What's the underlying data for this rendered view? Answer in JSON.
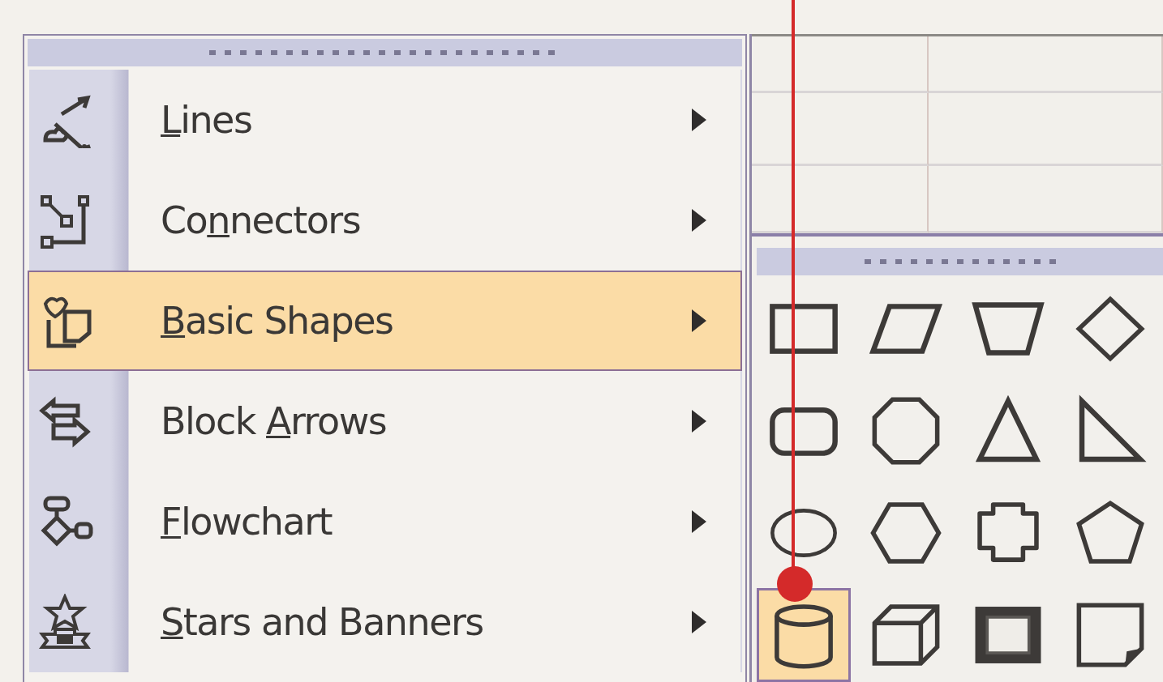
{
  "autoshapes_menu": {
    "items": [
      {
        "kind": "lines",
        "mnemonic": "L",
        "after": "ines",
        "selected": false
      },
      {
        "kind": "connectors",
        "before": "Co",
        "mnemonic": "n",
        "after": "nectors",
        "selected": false
      },
      {
        "kind": "basic-shapes",
        "mnemonic": "B",
        "after": "asic Shapes",
        "selected": true
      },
      {
        "kind": "block-arrows",
        "before": "Block ",
        "mnemonic": "A",
        "after": "rrows",
        "selected": false
      },
      {
        "kind": "flowchart",
        "mnemonic": "F",
        "after": "lowchart",
        "selected": false
      },
      {
        "kind": "stars-banners",
        "mnemonic": "S",
        "after": "tars and Banners",
        "selected": false
      }
    ]
  },
  "basic_shapes_palette": {
    "shapes": [
      {
        "kind": "rectangle",
        "selected": false
      },
      {
        "kind": "parallelogram",
        "selected": false
      },
      {
        "kind": "trapezoid",
        "selected": false
      },
      {
        "kind": "diamond",
        "selected": false
      },
      {
        "kind": "rounded-rectangle",
        "selected": false
      },
      {
        "kind": "octagon",
        "selected": false
      },
      {
        "kind": "triangle",
        "selected": false
      },
      {
        "kind": "right-triangle",
        "selected": false
      },
      {
        "kind": "oval",
        "selected": false
      },
      {
        "kind": "hexagon",
        "selected": false
      },
      {
        "kind": "cross",
        "selected": false
      },
      {
        "kind": "pentagon",
        "selected": false
      },
      {
        "kind": "cylinder",
        "selected": true
      },
      {
        "kind": "cube",
        "selected": false
      },
      {
        "kind": "bevel",
        "selected": false
      },
      {
        "kind": "folded-corner",
        "selected": false
      }
    ]
  }
}
